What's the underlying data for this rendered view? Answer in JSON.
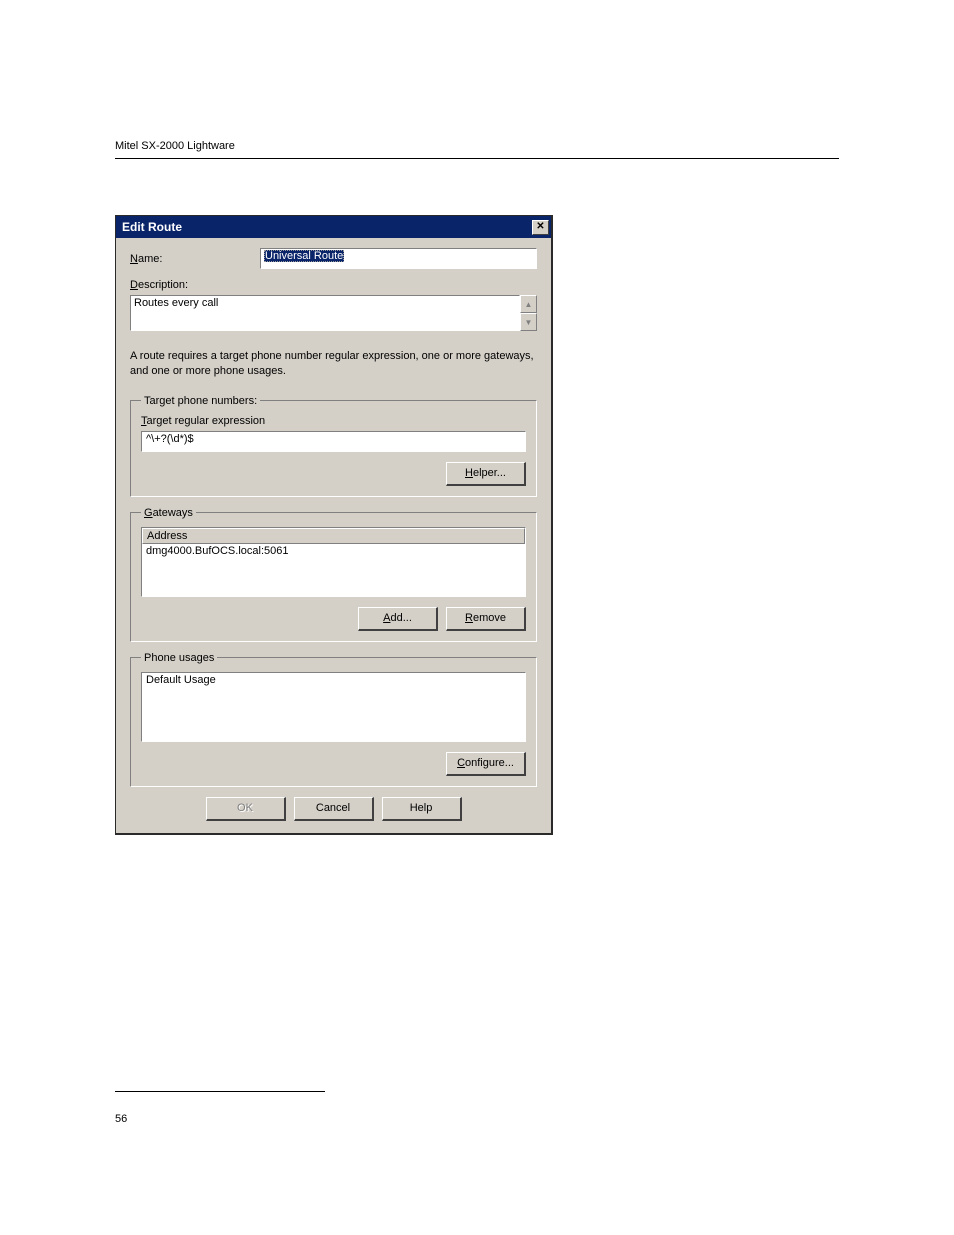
{
  "document": {
    "header_text": "Mitel SX-2000 Lightware",
    "page_number": "56"
  },
  "dialog": {
    "title": "Edit Route",
    "name_label_prefix": "N",
    "name_label_rest": "ame:",
    "name_value": "Universal Route",
    "description_label_prefix": "D",
    "description_label_rest": "escription:",
    "description_value": "Routes every call",
    "info_text": "A route requires a target phone number regular expression, one or more gateways, and one or more phone usages.",
    "target_group_legend": "Target phone numbers:",
    "target_regex_label_prefix": "T",
    "target_regex_label_rest": "arget regular expression",
    "target_regex_value": "^\\+?(\\d*)$",
    "helper_button_prefix": "H",
    "helper_button_rest": "elper...",
    "gateways_legend_prefix": "G",
    "gateways_legend_rest": "ateways",
    "gateways_header": "Address",
    "gateways_item": "dmg4000.BufOCS.local:5061",
    "add_button_prefix": "A",
    "add_button_rest": "dd...",
    "remove_button_prefix": "R",
    "remove_button_rest": "emove",
    "phone_usages_legend": "Phone usages",
    "phone_usages_item": "Default Usage",
    "configure_button_prefix": "C",
    "configure_button_rest": "onfigure...",
    "ok_button": "OK",
    "cancel_button": "Cancel",
    "help_button": "Help"
  }
}
